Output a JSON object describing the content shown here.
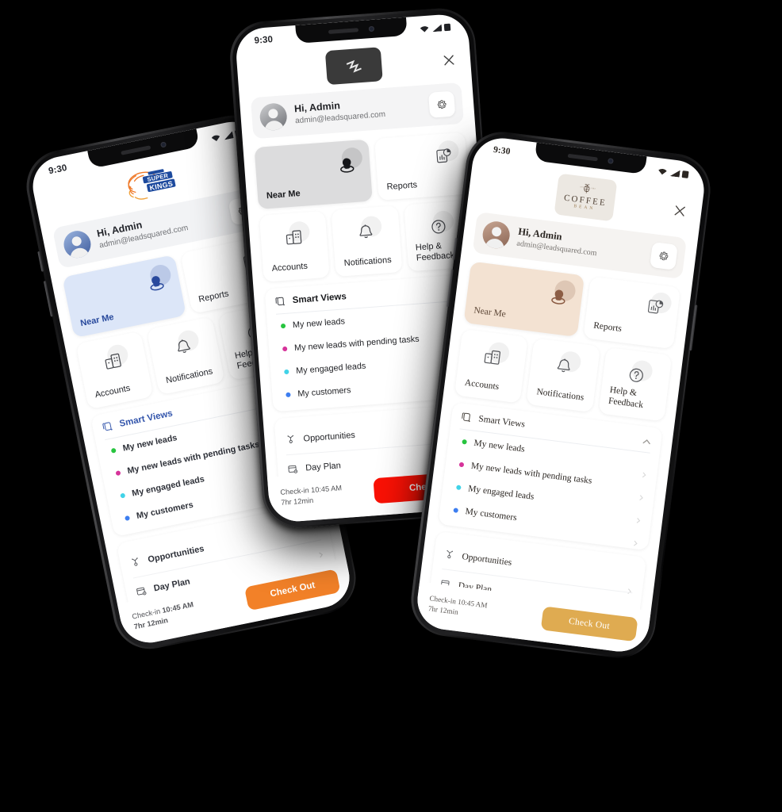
{
  "scene": {
    "background": "#000000",
    "phone_count": 3
  },
  "phones": [
    {
      "id": "phone-left",
      "theme_name": "chennai-super-kings",
      "accent": "#28499c",
      "tile_active_bg": "#dce6f8",
      "checkout_color": "#f28128",
      "logo": "csk-logo",
      "status": {
        "time": "9:30",
        "wifi": "wifi-icon",
        "signal": "signal-icon",
        "battery": "battery-icon"
      },
      "header": {
        "close_label": "×"
      },
      "profile": {
        "greeting": "Hi, Admin",
        "email": "admin@leadsquared.com",
        "settings_icon": "gear-icon"
      },
      "tiles": [
        {
          "label": "Near Me",
          "icon": "near-me-icon",
          "active": true
        },
        {
          "label": "Reports",
          "icon": "reports-icon",
          "active": false
        },
        {
          "label": "Accounts",
          "icon": "accounts-icon",
          "active": false
        },
        {
          "label": "Notifications",
          "icon": "bell-icon",
          "active": false
        },
        {
          "label": "Help & Feedback",
          "icon": "help-icon",
          "active": false
        }
      ],
      "smart_views": {
        "title": "Smart Views",
        "icon": "smart-views-icon",
        "items": [
          {
            "label": "My new leads",
            "color": "#27c43f"
          },
          {
            "label": "My new leads with pending tasks",
            "color": "#d6339a"
          },
          {
            "label": "My engaged leads",
            "color": "#41d3e8"
          },
          {
            "label": "My customers",
            "color": "#3d7ef0"
          }
        ]
      },
      "links": [
        {
          "label": "Opportunities",
          "icon": "opportunities-icon"
        },
        {
          "label": "Day Plan",
          "icon": "day-plan-icon"
        }
      ],
      "footer": {
        "checkin_label": "Check-in",
        "checkin_time": "10:45 AM",
        "duration": "7hr 12min",
        "button": "Check Out"
      }
    },
    {
      "id": "phone-middle",
      "theme_name": "leadsquared-default",
      "accent": "#17181b",
      "tile_active_bg": "#dcdcdd",
      "checkout_color": "#fa1105",
      "logo": "leadsquared-logo",
      "status": {
        "time": "9:30",
        "wifi": "wifi-icon",
        "signal": "signal-icon",
        "battery": "battery-icon"
      },
      "header": {
        "close_label": "×"
      },
      "profile": {
        "greeting": "Hi, Admin",
        "email": "admin@leadsquared.com",
        "settings_icon": "gear-icon"
      },
      "tiles": [
        {
          "label": "Near Me",
          "icon": "near-me-icon",
          "active": true
        },
        {
          "label": "Reports",
          "icon": "reports-icon",
          "active": false
        },
        {
          "label": "Accounts",
          "icon": "accounts-icon",
          "active": false
        },
        {
          "label": "Notifications",
          "icon": "bell-icon",
          "active": false
        },
        {
          "label": "Help & Feedback",
          "icon": "help-icon",
          "active": false
        }
      ],
      "smart_views": {
        "title": "Smart Views",
        "icon": "smart-views-icon",
        "items": [
          {
            "label": "My new leads",
            "color": "#27c43f"
          },
          {
            "label": "My new leads with pending tasks",
            "color": "#d6339a"
          },
          {
            "label": "My engaged leads",
            "color": "#41d3e8"
          },
          {
            "label": "My customers",
            "color": "#3d7ef0"
          }
        ]
      },
      "links": [
        {
          "label": "Opportunities",
          "icon": "opportunities-icon"
        },
        {
          "label": "Day Plan",
          "icon": "day-plan-icon"
        }
      ],
      "footer": {
        "checkin_label": "Check-in",
        "checkin_time": "10:45 AM",
        "duration": "7hr 12min",
        "button": "Check Out"
      }
    },
    {
      "id": "phone-right",
      "theme_name": "coffee-bean",
      "accent": "#8a6453",
      "tile_active_bg": "#f3e2d2",
      "checkout_color": "#dfab51",
      "logo": "coffee-bean-logo",
      "logo_text": {
        "line1": "COFFEE",
        "line2": "BEAN"
      },
      "status": {
        "time": "9:30",
        "wifi": "wifi-icon",
        "signal": "signal-icon",
        "battery": "battery-icon"
      },
      "header": {
        "close_label": "×"
      },
      "profile": {
        "greeting": "Hi, Admin",
        "email": "admin@leadsquared.com",
        "settings_icon": "gear-icon"
      },
      "tiles": [
        {
          "label": "Near Me",
          "icon": "near-me-icon",
          "active": true
        },
        {
          "label": "Reports",
          "icon": "reports-icon",
          "active": false
        },
        {
          "label": "Accounts",
          "icon": "accounts-icon",
          "active": false
        },
        {
          "label": "Notifications",
          "icon": "bell-icon",
          "active": false
        },
        {
          "label": "Help & Feedback",
          "icon": "help-icon",
          "active": false
        }
      ],
      "smart_views": {
        "title": "Smart Views",
        "icon": "smart-views-icon",
        "collapse_icon": "chevron-up-icon",
        "items": [
          {
            "label": "My new leads",
            "color": "#27c43f"
          },
          {
            "label": "My new leads with pending tasks",
            "color": "#d6339a"
          },
          {
            "label": "My engaged leads",
            "color": "#41d3e8"
          },
          {
            "label": "My customers",
            "color": "#3d7ef0"
          }
        ]
      },
      "links": [
        {
          "label": "Opportunities",
          "icon": "opportunities-icon"
        },
        {
          "label": "Day Plan",
          "icon": "day-plan-icon"
        }
      ],
      "footer": {
        "checkin_label": "Check-in",
        "checkin_time": "10:45 AM",
        "duration": "7hr 12min",
        "button": "Check Out"
      }
    }
  ]
}
